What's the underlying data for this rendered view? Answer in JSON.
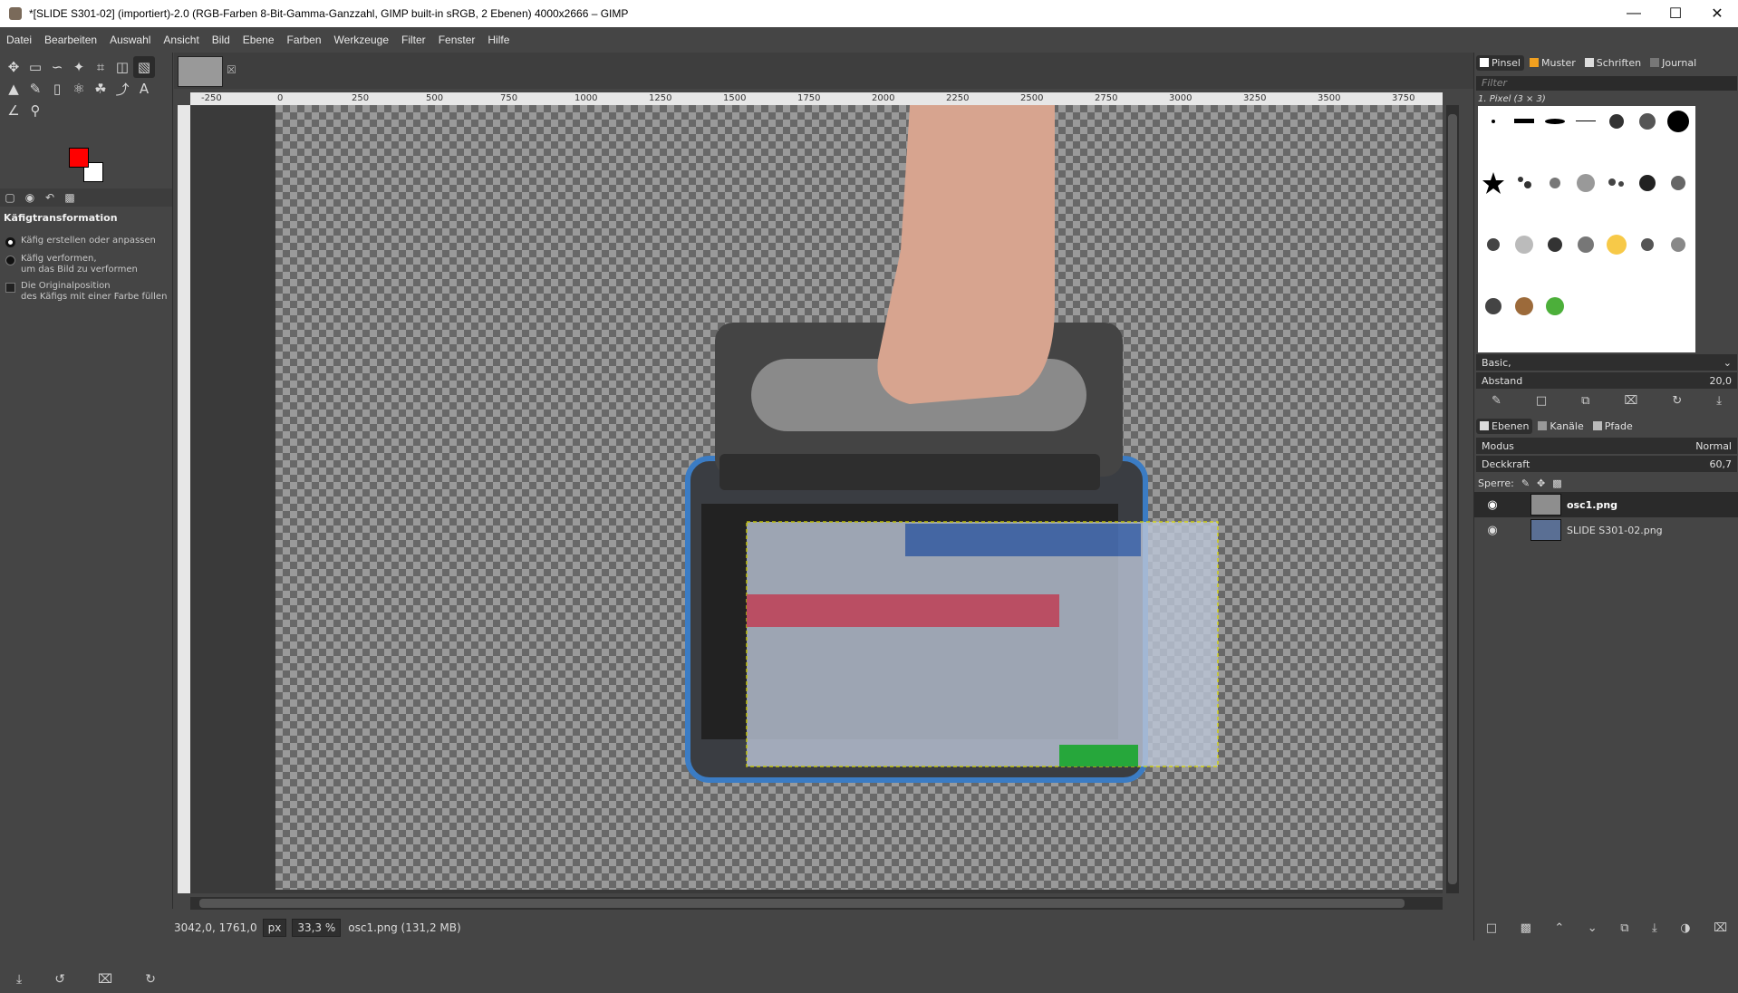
{
  "window": {
    "title": "*[SLIDE S301-02] (importiert)-2.0 (RGB-Farben 8-Bit-Gamma-Ganzzahl, GIMP built-in sRGB, 2 Ebenen) 4000x2666 – GIMP"
  },
  "menu": [
    "Datei",
    "Bearbeiten",
    "Auswahl",
    "Ansicht",
    "Bild",
    "Ebene",
    "Farben",
    "Werkzeuge",
    "Filter",
    "Fenster",
    "Hilfe"
  ],
  "colors": {
    "foreground": "#ff0000",
    "background": "#ffffff"
  },
  "tool_options": {
    "title": "Käfigtransformation",
    "option1": "Käfig erstellen oder anpassen",
    "option2a": "Käfig verformen,",
    "option2b": "um das Bild zu verformen",
    "option3a": "Die Originalposition",
    "option3b": "des Käfigs mit einer Farbe füllen"
  },
  "ruler": {
    "h_ticks": [
      "-250",
      "0",
      "250",
      "500",
      "750",
      "1000",
      "1250",
      "1500",
      "1750",
      "2000",
      "2250",
      "2500",
      "2750",
      "3000",
      "3250",
      "3500",
      "3750"
    ]
  },
  "status": {
    "coords": "3042,0, 1761,0",
    "unit": "px",
    "zoom": "33,3 %",
    "file": "osc1.png (131,2 MB)"
  },
  "dock": {
    "tabs": {
      "brushes": "Pinsel",
      "patterns": "Muster",
      "fonts": "Schriften",
      "journal": "Journal"
    },
    "filter_placeholder": "Filter",
    "brush_name": "1. Pixel (3 × 3)",
    "preset": "Basic,",
    "spacing_label": "Abstand",
    "spacing_value": "20,0",
    "layer_tabs": {
      "layers": "Ebenen",
      "channels": "Kanäle",
      "paths": "Pfade"
    },
    "mode_label": "Modus",
    "mode_value": "Normal",
    "opacity_label": "Deckkraft",
    "opacity_value": "60,7",
    "lock_label": "Sperre:",
    "layers": [
      {
        "name": "osc1.png",
        "selected": true
      },
      {
        "name": "SLIDE S301-02.png",
        "selected": false
      }
    ]
  }
}
